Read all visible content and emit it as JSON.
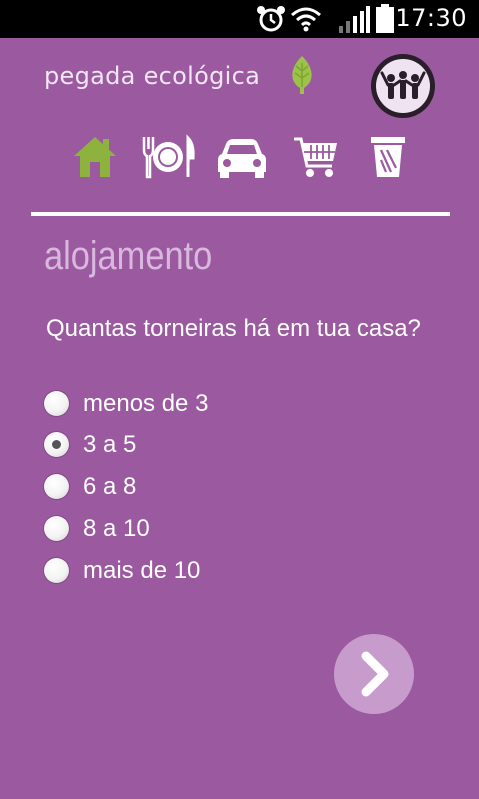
{
  "statusbar": {
    "time": "17:30",
    "icons": [
      "alarm-icon",
      "wifi-icon",
      "signal-icon",
      "battery-icon"
    ]
  },
  "header": {
    "app_title": "pegada ecológica",
    "logo_icon": "leaf-icon",
    "profile_icon": "people-group-icon"
  },
  "nav": {
    "icons": [
      "home-icon",
      "food-icon",
      "car-icon",
      "cart-icon",
      "trash-icon"
    ],
    "active": "home-icon",
    "active_color": "#8db33e",
    "inactive_color": "#ffffff"
  },
  "section": {
    "title": "alojamento"
  },
  "question": {
    "text": "Quantas torneiras há em tua casa?",
    "options": [
      {
        "label": "menos de 3",
        "checked": false
      },
      {
        "label": "3 a 5",
        "checked": true
      },
      {
        "label": "6 a 8",
        "checked": false
      },
      {
        "label": "8 a 10",
        "checked": false
      },
      {
        "label": "mais de 10",
        "checked": false
      }
    ]
  },
  "next_button": {
    "icon": "chevron-right-icon"
  },
  "colors": {
    "background": "#9b59a0",
    "section_title": "#d8b8dc",
    "next_button": "#c79ccc"
  }
}
